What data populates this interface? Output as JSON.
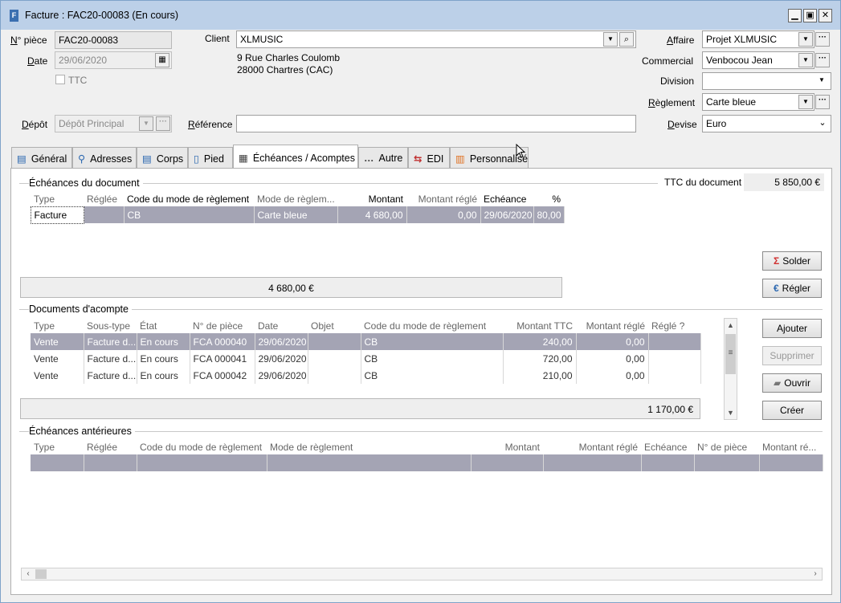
{
  "window": {
    "title": "Facture : FAC20-00083 (En cours)",
    "icon": "invoice-icon"
  },
  "header": {
    "piece_label": "N° pièce",
    "piece_value": "FAC20-00083",
    "date_label": "Date",
    "date_value": "29/06/2020",
    "ttc_label": "TTC",
    "depot_label": "Dépôt",
    "depot_value": "Dépôt Principal",
    "client_label": "Client",
    "client_value": "XLMUSIC",
    "address_line1": "9 Rue Charles Coulomb",
    "address_line2": "28000 Chartres (CAC)",
    "reference_label": "Référence",
    "reference_value": "",
    "affaire_label": "Affaire",
    "affaire_value": "Projet XLMUSIC",
    "commercial_label": "Commercial",
    "commercial_value": "Venbocou Jean",
    "division_label": "Division",
    "division_value": "",
    "reglement_label": "Règlement",
    "reglement_value": "Carte bleue",
    "devise_label": "Devise",
    "devise_value": "Euro"
  },
  "tabs": [
    {
      "label": "Général",
      "icon": "invoice-icon"
    },
    {
      "label": "Adresses",
      "icon": "map-pin-icon"
    },
    {
      "label": "Corps",
      "icon": "document-lines-icon"
    },
    {
      "label": "Pied",
      "icon": "page-icon"
    },
    {
      "label": "Échéances / Acomptes",
      "icon": "calendar-icon"
    },
    {
      "label": "Autre",
      "icon": "ellipsis-icon"
    },
    {
      "label": "EDI",
      "icon": "exchange-icon"
    },
    {
      "label": "Personnalisé",
      "icon": "custom-fields-icon"
    }
  ],
  "echeances": {
    "title": "Échéances du document",
    "ttc_label": "TTC du document",
    "ttc_value": "5 850,00 €",
    "columns": [
      "Type",
      "Réglée",
      "Code du mode de règlement",
      "Mode de règlem...",
      "Montant",
      "Montant réglé",
      "Echéance",
      "%"
    ],
    "rows": [
      [
        "Facture",
        "",
        "CB",
        "Carte bleue",
        "4 680,00",
        "0,00",
        "29/06/2020",
        "80,00"
      ]
    ],
    "total": "4 680,00 €",
    "solder_label": "Solder",
    "regler_label": "Régler"
  },
  "acomptes": {
    "title": "Documents d'acompte",
    "columns": [
      "Type",
      "Sous-type",
      "État",
      "N° de pièce",
      "Date",
      "Objet",
      "Code du mode de règlement",
      "Montant TTC",
      "Montant réglé",
      "Réglé ?"
    ],
    "rows": [
      [
        "Vente",
        "Facture d...",
        "En cours",
        "FCA 000040",
        "29/06/2020",
        "",
        "CB",
        "240,00",
        "0,00",
        ""
      ],
      [
        "Vente",
        "Facture d...",
        "En cours",
        "FCA 000041",
        "29/06/2020",
        "",
        "CB",
        "720,00",
        "0,00",
        ""
      ],
      [
        "Vente",
        "Facture d...",
        "En cours",
        "FCA 000042",
        "29/06/2020",
        "",
        "CB",
        "210,00",
        "0,00",
        ""
      ]
    ],
    "total": "1 170,00 €",
    "ajouter_label": "Ajouter",
    "supprimer_label": "Supprimer",
    "ouvrir_label": "Ouvrir",
    "creer_label": "Créer"
  },
  "anterieures": {
    "title": "Échéances antérieures",
    "columns": [
      "Type",
      "Réglée",
      "Code du mode de règlement",
      "Mode de règlement",
      "Montant",
      "Montant réglé",
      "Echéance",
      "N° de pièce",
      "Montant ré..."
    ]
  },
  "colors": {
    "titlebar": "#bcd0e8",
    "selected_row": "#a4a4b4",
    "accent": "#2c68b0"
  }
}
